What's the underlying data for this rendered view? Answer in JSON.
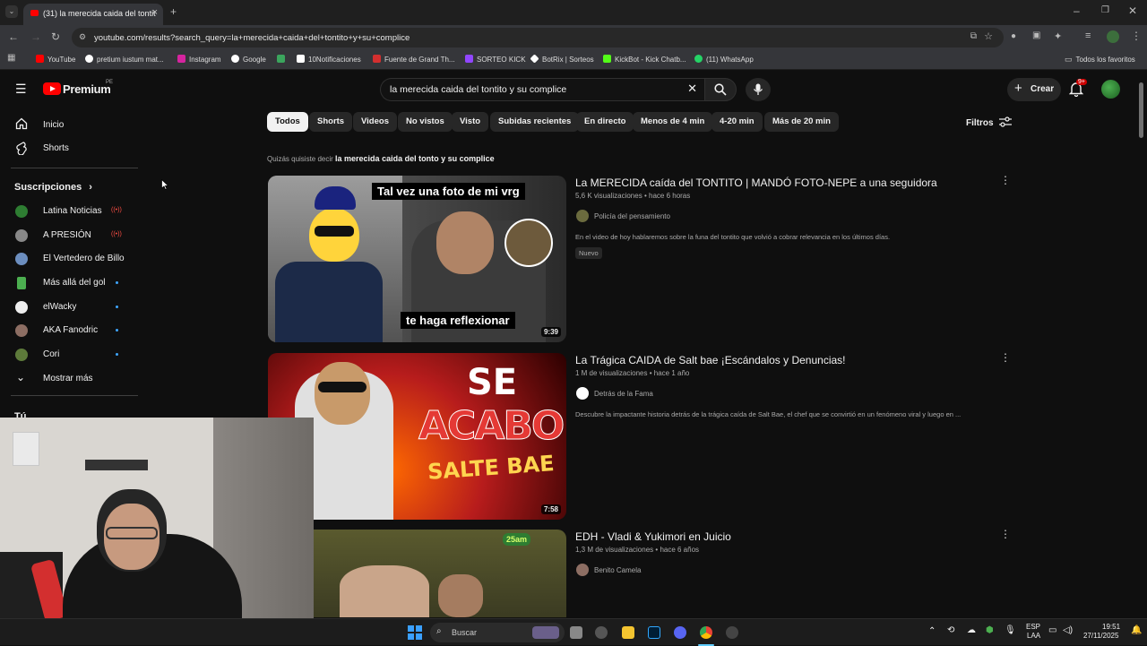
{
  "browser": {
    "tab_title": "(31) la merecida caida del tontit",
    "url": "youtube.com/results?search_query=la+merecida+caida+del+tontito+y+su+complice",
    "bookmarks": [
      {
        "label": "YouTube",
        "color": "#ff0000"
      },
      {
        "label": "pretium iustum mat...",
        "color": "#ffffff"
      },
      {
        "label": "Instagram",
        "color": "#d6249f"
      },
      {
        "label": "Google",
        "color": "#ffffff"
      },
      {
        "label": "",
        "color": "#3ba55d"
      },
      {
        "label": "10Notificaciones",
        "color": "#ffffff"
      },
      {
        "label": "Fuente de Grand Th...",
        "color": "#d32f2f"
      },
      {
        "label": "SORTEO KICK",
        "color": "#9146ff"
      },
      {
        "label": "BotRix | Sorteos",
        "color": "#ffffff"
      },
      {
        "label": "KickBot - Kick Chatb...",
        "color": "#53fc18"
      },
      {
        "label": "(11) WhatsApp",
        "color": "#25d366"
      }
    ],
    "all_favorites": "Todos los favoritos"
  },
  "header": {
    "logo": "Premium",
    "logo_badge": "PE",
    "search_value": "la merecida caida del tontito y su complice",
    "create_label": "Crear",
    "notif_count": "9+"
  },
  "sidebar": {
    "home": "Inicio",
    "shorts": "Shorts",
    "subs_heading": "Suscripciones",
    "channels": [
      {
        "name": "Latina Noticias",
        "status": "live",
        "color": "#2e7d32"
      },
      {
        "name": "A PRESIÓN",
        "status": "live",
        "color": "#888888"
      },
      {
        "name": "El Vertedero de Billo",
        "status": "",
        "color": "#6c8ebf"
      },
      {
        "name": "Más allá del gol",
        "status": "new",
        "color": "#4caf50"
      },
      {
        "name": "elWacky",
        "status": "new",
        "color": "#eeeeee"
      },
      {
        "name": "AKA Fanodric",
        "status": "new",
        "color": "#8d6e63"
      },
      {
        "name": "Cori",
        "status": "new",
        "color": "#5d7a3a"
      }
    ],
    "show_more": "Mostrar más",
    "you": "Tú"
  },
  "chips": [
    "Todos",
    "Shorts",
    "Videos",
    "No vistos",
    "Visto",
    "Subidas recientes",
    "En directo",
    "Menos de 4 min",
    "4-20 min",
    "Más de 20 min"
  ],
  "filters_label": "Filtros",
  "suggestion": {
    "prefix": "Quizás quisiste decir ",
    "query": "la merecida caida del tonto y su complice"
  },
  "results": [
    {
      "title": "La MERECIDA caída del TONTITO | MANDÓ FOTO-NEPE a una seguidora",
      "views": "5,6 K visualizaciones",
      "age": "hace 6 horas",
      "channel": "Policía del pensamiento",
      "description": "En el video de hoy hablaremos sobre la funa del tontito que volvió a cobrar relevancia en los últimos días.",
      "badge": "Nuevo",
      "duration": "9:39",
      "thumb_top": "Tal vez una foto de mi vrg",
      "thumb_bottom": "te haga reflexionar"
    },
    {
      "title": "La Trágica CAIDA de Salt bae ¡Escándalos y Denuncias!",
      "views": "1 M de visualizaciones",
      "age": "hace 1 año",
      "channel": "Detrás de la Fama",
      "description": "Descubre la impactante historia detrás de la trágica caída de Salt Bae, el chef que se convirtió en un fenómeno viral y luego en ...",
      "duration": "7:58",
      "thumb_l1": "SE",
      "thumb_l2": "ACABO",
      "thumb_l3": "SALTE BAE"
    },
    {
      "title": "EDH - Vladi & Yukimori en Juicio",
      "views": "1,3 M de visualizaciones",
      "age": "hace 6 años",
      "channel": "Benito Camela",
      "thumb_logo": "25am"
    }
  ],
  "taskbar": {
    "search": "Buscar",
    "lang1": "ESP",
    "lang2": "LAA",
    "time": "19:51",
    "date": "27/11/2025"
  },
  "dot_sep": "•"
}
